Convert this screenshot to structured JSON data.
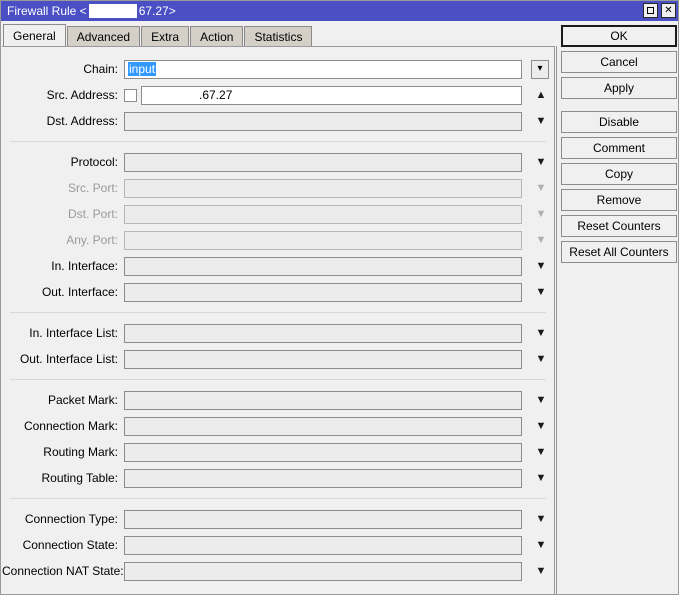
{
  "window": {
    "title_prefix": "Firewall Rule <",
    "title_suffix": "67.27>",
    "maximize_icon": "maximize-icon",
    "close_icon": "✕"
  },
  "tabs": [
    {
      "label": "General",
      "active": true
    },
    {
      "label": "Advanced",
      "active": false
    },
    {
      "label": "Extra",
      "active": false
    },
    {
      "label": "Action",
      "active": false
    },
    {
      "label": "Statistics",
      "active": false
    }
  ],
  "form": {
    "groups": [
      {
        "rows": [
          {
            "label": "Chain:",
            "value": "input",
            "value_selected": true,
            "control": "combo-button",
            "disabled": false,
            "editable": true
          },
          {
            "label": "Src. Address:",
            "value": ".67.27",
            "checkbox": true,
            "redacted_prefix": true,
            "control": "up-arrow",
            "disabled": false,
            "editable": true
          },
          {
            "label": "Dst. Address:",
            "value": "",
            "control": "down-arrow",
            "disabled": false,
            "editable": false
          }
        ]
      },
      {
        "rows": [
          {
            "label": "Protocol:",
            "value": "",
            "control": "down-arrow",
            "disabled": false,
            "editable": false
          },
          {
            "label": "Src. Port:",
            "value": "",
            "control": "down-arrow",
            "disabled": true,
            "editable": false
          },
          {
            "label": "Dst. Port:",
            "value": "",
            "control": "down-arrow",
            "disabled": true,
            "editable": false
          },
          {
            "label": "Any. Port:",
            "value": "",
            "control": "down-arrow",
            "disabled": true,
            "editable": false
          },
          {
            "label": "In. Interface:",
            "value": "",
            "control": "down-arrow",
            "disabled": false,
            "editable": false
          },
          {
            "label": "Out. Interface:",
            "value": "",
            "control": "down-arrow",
            "disabled": false,
            "editable": false
          }
        ]
      },
      {
        "rows": [
          {
            "label": "In. Interface List:",
            "value": "",
            "control": "down-arrow",
            "disabled": false,
            "editable": false
          },
          {
            "label": "Out. Interface List:",
            "value": "",
            "control": "down-arrow",
            "disabled": false,
            "editable": false
          }
        ]
      },
      {
        "rows": [
          {
            "label": "Packet Mark:",
            "value": "",
            "control": "down-arrow",
            "disabled": false,
            "editable": false
          },
          {
            "label": "Connection Mark:",
            "value": "",
            "control": "down-arrow",
            "disabled": false,
            "editable": false
          },
          {
            "label": "Routing Mark:",
            "value": "",
            "control": "down-arrow",
            "disabled": false,
            "editable": false
          },
          {
            "label": "Routing Table:",
            "value": "",
            "control": "down-arrow",
            "disabled": false,
            "editable": false
          }
        ]
      },
      {
        "rows": [
          {
            "label": "Connection Type:",
            "value": "",
            "control": "down-arrow",
            "disabled": false,
            "editable": false
          },
          {
            "label": "Connection State:",
            "value": "",
            "control": "down-arrow",
            "disabled": false,
            "editable": false
          },
          {
            "label": "Connection NAT State:",
            "value": "",
            "control": "down-arrow",
            "disabled": false,
            "editable": false
          }
        ]
      }
    ]
  },
  "buttons": [
    {
      "label": "OK",
      "primary": true,
      "gap_after": false
    },
    {
      "label": "Cancel",
      "primary": false,
      "gap_after": false
    },
    {
      "label": "Apply",
      "primary": false,
      "gap_after": true
    },
    {
      "label": "Disable",
      "primary": false,
      "gap_after": false
    },
    {
      "label": "Comment",
      "primary": false,
      "gap_after": false
    },
    {
      "label": "Copy",
      "primary": false,
      "gap_after": false
    },
    {
      "label": "Remove",
      "primary": false,
      "gap_after": false
    },
    {
      "label": "Reset Counters",
      "primary": false,
      "gap_after": false
    },
    {
      "label": "Reset All Counters",
      "primary": false,
      "gap_after": false
    }
  ],
  "colors": {
    "titlebar": "#4a4fc4",
    "window_bg": "#f0f0f0",
    "selection": "#3399ff",
    "field_border": "#8c8c8c",
    "disabled_text": "#9a9a9a"
  }
}
